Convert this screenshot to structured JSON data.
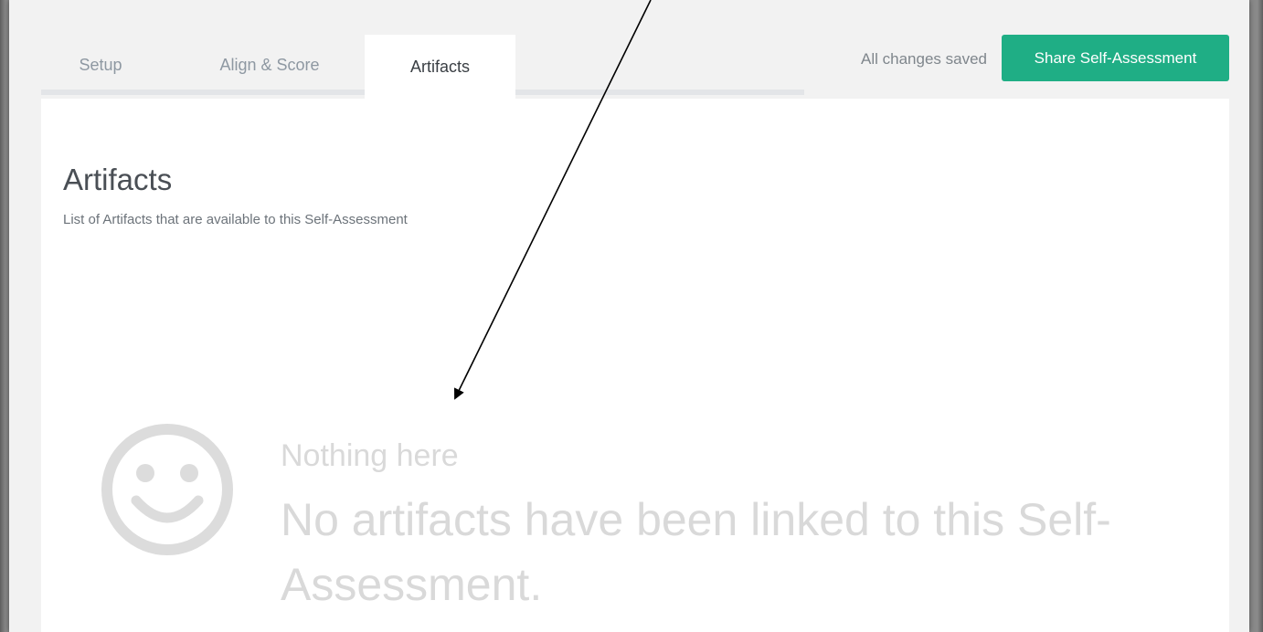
{
  "tabs": [
    {
      "label": "Setup",
      "active": false
    },
    {
      "label": "Align & Score",
      "active": false
    },
    {
      "label": "Artifacts",
      "active": true
    }
  ],
  "header": {
    "status": "All changes saved",
    "share_button": "Share Self-Assessment"
  },
  "page": {
    "title": "Artifacts",
    "subtitle": "List of Artifacts that are available to this Self-Assessment"
  },
  "empty_state": {
    "icon": "smiley-icon",
    "heading": "Nothing here",
    "message": "No artifacts have been linked to this Self-Assessment."
  },
  "colors": {
    "accent": "#1fae85",
    "empty_text": "#d9d9d9"
  }
}
